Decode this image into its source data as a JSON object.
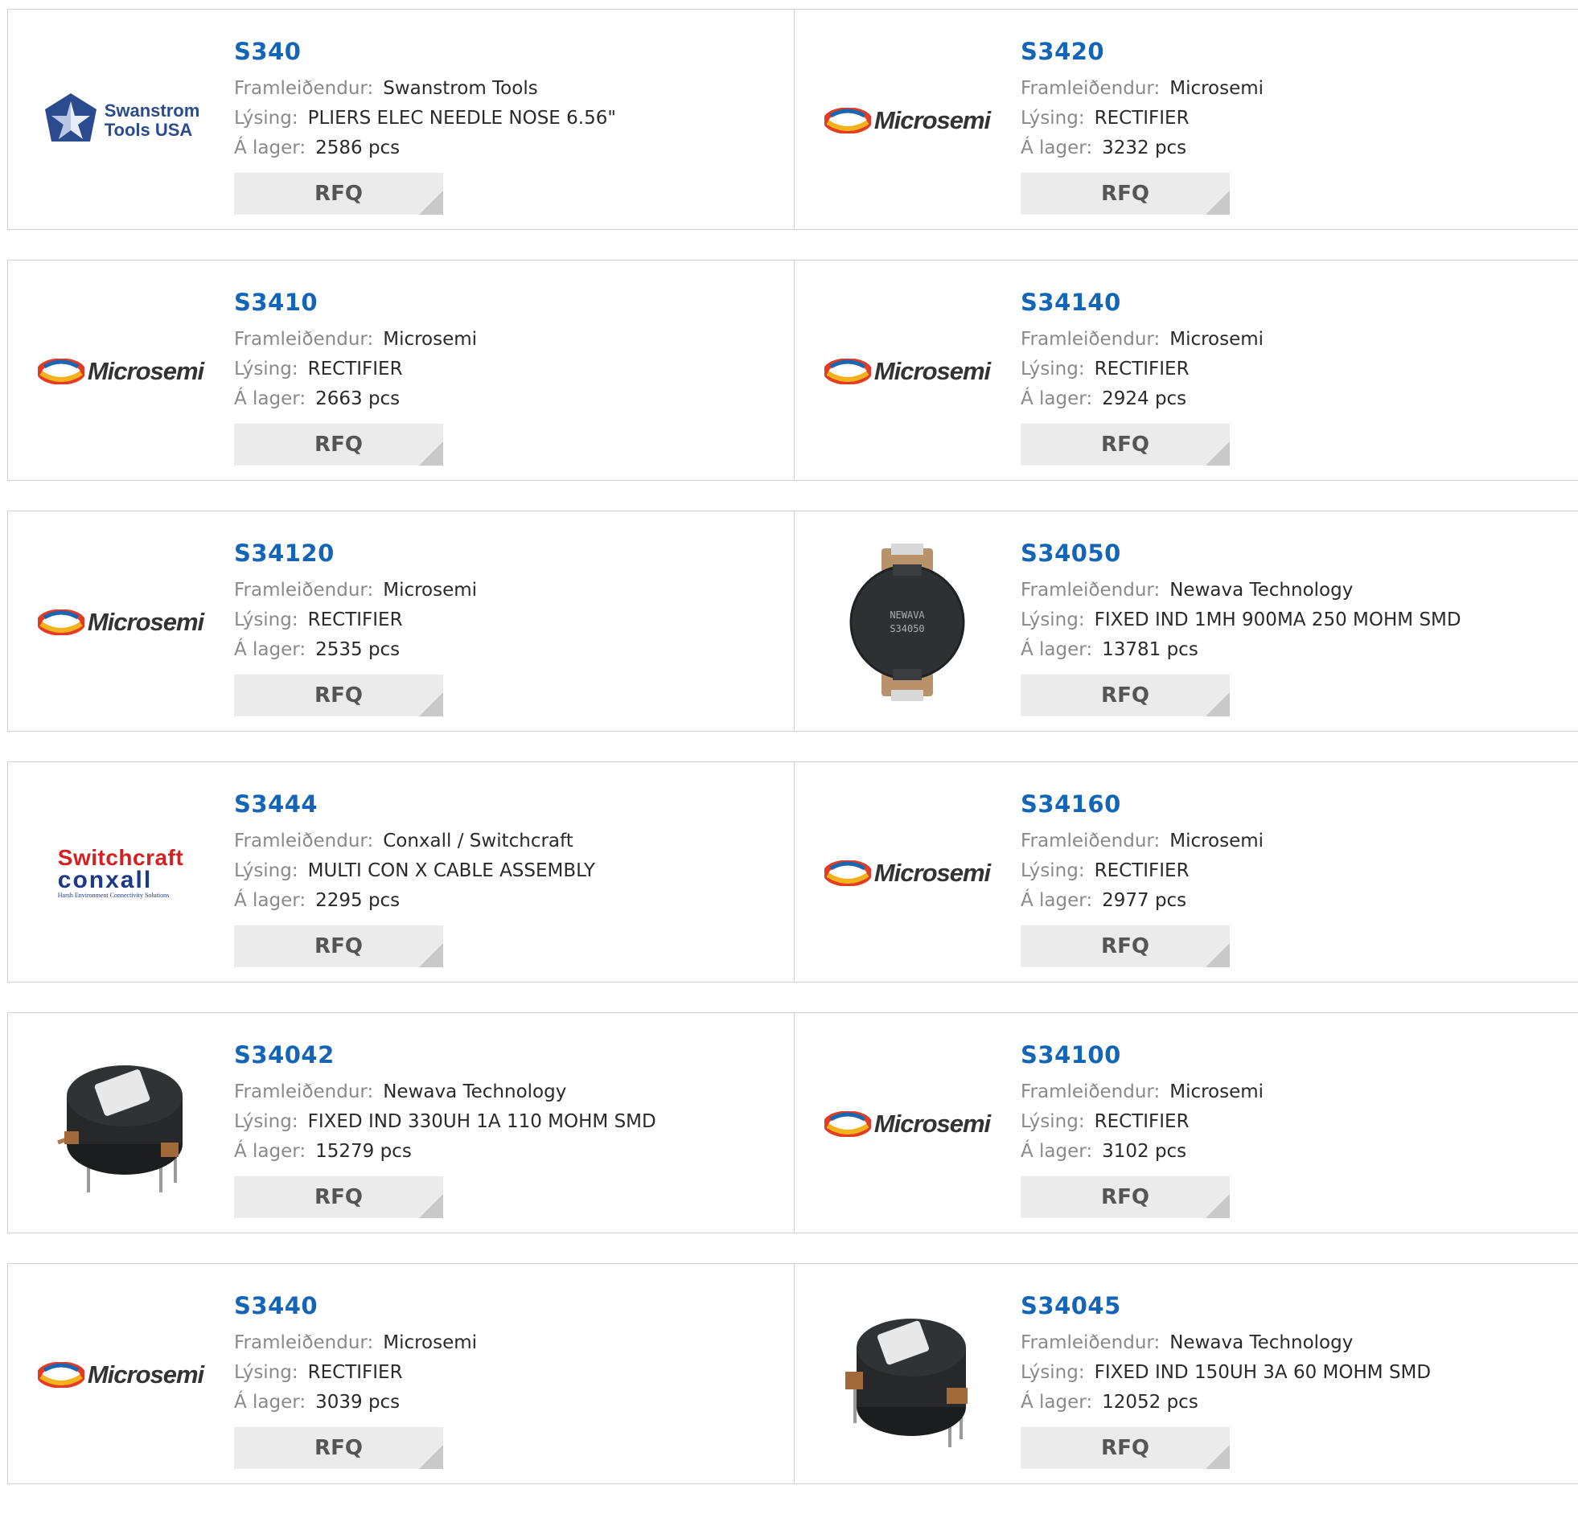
{
  "labels": {
    "manufacturer": "Framleiðendur:",
    "description": "Lýsing:",
    "stock": "Á lager:",
    "rfq": "RFQ"
  },
  "logos": {
    "microsemi": "Microsemi",
    "swanstrom_line1": "Swanstrom",
    "swanstrom_line2": "Tools USA",
    "switchcraft": "Switchcraft",
    "conxall": "conxall",
    "conxall_tagline": "Harsh Environment Connectivity Solutions",
    "newava_marking_line1": "NEWAVA",
    "newava_marking_line2": "S34050"
  },
  "colors": {
    "part_link": "#1565b6",
    "label_gray": "#8a8a8a",
    "rfq_bg": "#ebebeb",
    "rfq_corner": "#c9c9c9"
  },
  "products": [
    {
      "part": "S340",
      "manufacturer": "Swanstrom Tools",
      "description": "PLIERS ELEC NEEDLE NOSE 6.56\"",
      "stock": "2586 pcs",
      "image": "swanstrom-logo"
    },
    {
      "part": "S3420",
      "manufacturer": "Microsemi",
      "description": "RECTIFIER",
      "stock": "3232 pcs",
      "image": "microsemi-logo"
    },
    {
      "part": "S3410",
      "manufacturer": "Microsemi",
      "description": "RECTIFIER",
      "stock": "2663 pcs",
      "image": "microsemi-logo"
    },
    {
      "part": "S34140",
      "manufacturer": "Microsemi",
      "description": "RECTIFIER",
      "stock": "2924 pcs",
      "image": "microsemi-logo"
    },
    {
      "part": "S34120",
      "manufacturer": "Microsemi",
      "description": "RECTIFIER",
      "stock": "2535 pcs",
      "image": "microsemi-logo"
    },
    {
      "part": "S34050",
      "manufacturer": "Newava Technology",
      "description": "FIXED IND 1MH 900MA 250 MOHM SMD",
      "stock": "13781 pcs",
      "image": "smd-inductor-photo"
    },
    {
      "part": "S3444",
      "manufacturer": "Conxall / Switchcraft",
      "description": "MULTI CON X CABLE ASSEMBLY",
      "stock": "2295 pcs",
      "image": "switchcraft-conxall-logo"
    },
    {
      "part": "S34160",
      "manufacturer": "Microsemi",
      "description": "RECTIFIER",
      "stock": "2977 pcs",
      "image": "microsemi-logo"
    },
    {
      "part": "S34042",
      "manufacturer": "Newava Technology",
      "description": "FIXED IND 330UH 1A 110 MOHM SMD",
      "stock": "15279 pcs",
      "image": "through-hole-inductor-photo"
    },
    {
      "part": "S34100",
      "manufacturer": "Microsemi",
      "description": "RECTIFIER",
      "stock": "3102 pcs",
      "image": "microsemi-logo"
    },
    {
      "part": "S3440",
      "manufacturer": "Microsemi",
      "description": "RECTIFIER",
      "stock": "3039 pcs",
      "image": "microsemi-logo"
    },
    {
      "part": "S34045",
      "manufacturer": "Newava Technology",
      "description": "FIXED IND 150UH 3A 60 MOHM SMD",
      "stock": "12052 pcs",
      "image": "through-hole-inductor-photo"
    }
  ]
}
